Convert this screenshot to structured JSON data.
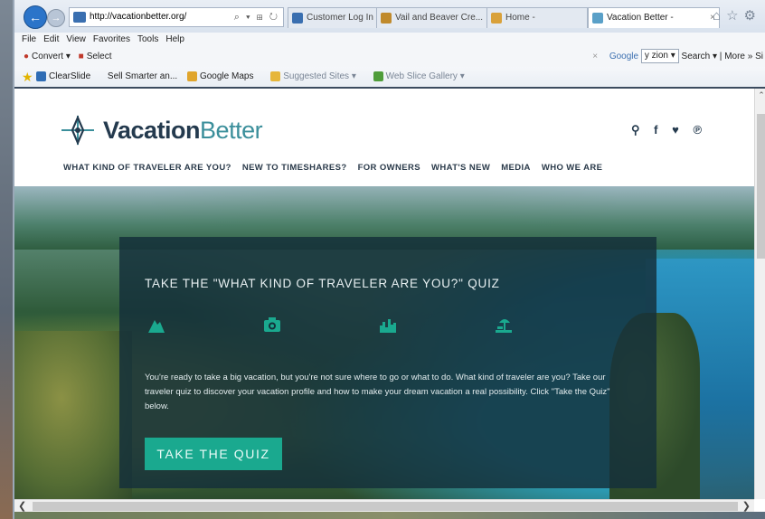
{
  "browser": {
    "url": "http://vacationbetter.org/",
    "address_controls": "⌕ ▾ ⊞ ↻",
    "tabs": [
      {
        "label": "Customer Log In | ...",
        "color": "#3a6fb0",
        "active": false
      },
      {
        "label": "Vail and Beaver Cre...",
        "color": "#c08a2c",
        "active": false
      },
      {
        "label": "Home -",
        "color": "#d9a13a",
        "active": false
      },
      {
        "label": "Vacation Better -",
        "color": "#5aa0c8",
        "active": true
      }
    ],
    "tab_close": "×",
    "window_icons": "⌂☆⚙",
    "menu": [
      "File",
      "Edit",
      "View",
      "Favorites",
      "Tools",
      "Help"
    ],
    "commandbar": {
      "convert": "Convert",
      "convert_arrow": "▾",
      "select": "Select",
      "search_close": "×",
      "google_label": "Google",
      "google_dropdown": "y zion ▾",
      "search_label": "Search ▾",
      "more_label": "More »",
      "sign_label": "Si"
    },
    "favorites": [
      {
        "label": "ClearSlide",
        "color": "#2f6db5"
      },
      {
        "label": "Sell Smarter an...",
        "color": "#ffffff"
      },
      {
        "label": "Google Maps",
        "color": "#e0a52c"
      },
      {
        "label": "Suggested Sites ▾",
        "color": "#e6b63a",
        "muted": true
      },
      {
        "label": "Web Slice Gallery ▾",
        "color": "#4f9d3a",
        "muted": true
      }
    ]
  },
  "site": {
    "logo_bold": "Vacation",
    "logo_light": "Better",
    "social": [
      "⚲",
      "f",
      "♥",
      "℗"
    ],
    "nav": [
      "WHAT KIND OF TRAVELER ARE YOU?",
      "NEW TO TIMESHARES?",
      "FOR OWNERS",
      "WHAT'S NEW",
      "MEDIA",
      "WHO WE ARE"
    ],
    "quiz": {
      "title": "TAKE THE \"WHAT KIND OF TRAVELER ARE YOU?\" QUIZ",
      "icons": [
        "mountain-icon",
        "camera-icon",
        "city-icon",
        "beach-icon"
      ],
      "text": "You're ready to take a big vacation, but you're not sure where to go or what to do. What kind of traveler are you? Take our traveler quiz to discover your vacation profile and how to make your dream vacation a real possibility. Click \"Take the Quiz\" below.",
      "button": "TAKE THE QUIZ"
    }
  },
  "colors": {
    "accent": "#1aa98f",
    "brand_dark": "#243a4e",
    "brand_light": "#3b8f9b",
    "quiz_bg": "#14303a"
  }
}
